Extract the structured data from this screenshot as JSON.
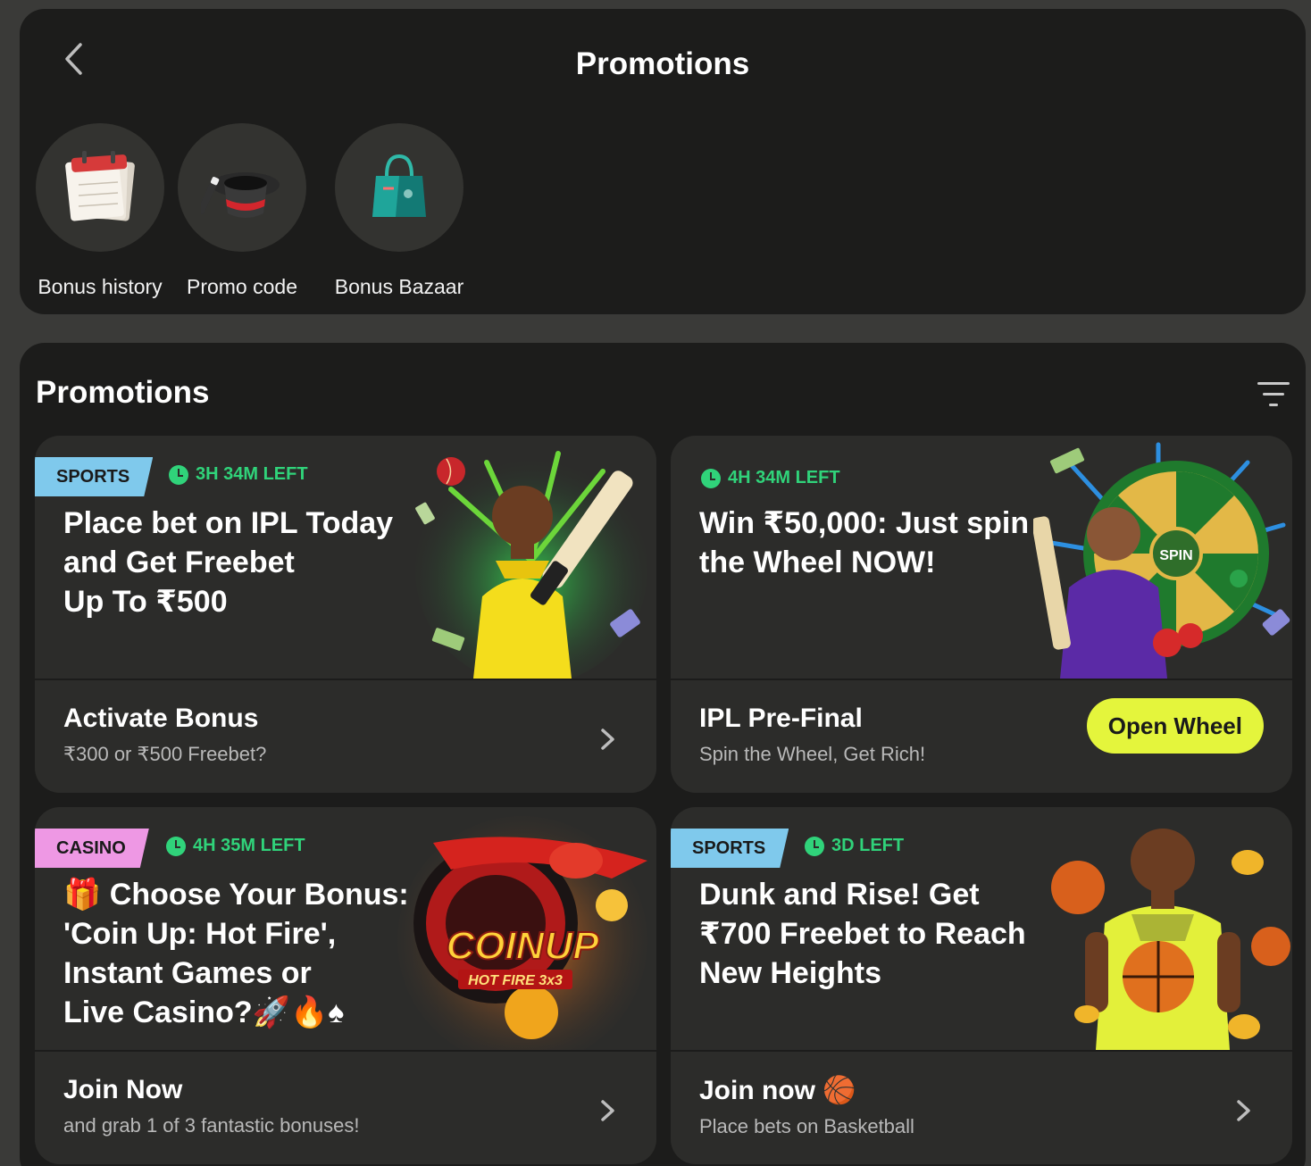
{
  "header": {
    "title": "Promotions"
  },
  "quick_links": [
    {
      "label": "Bonus history",
      "icon": "calendar-icon"
    },
    {
      "label": "Promo code",
      "icon": "magic-hat-icon"
    },
    {
      "label": "Bonus Bazaar",
      "icon": "shopping-bag-icon"
    }
  ],
  "section": {
    "title": "Promotions"
  },
  "cards": [
    {
      "tag": "SPORTS",
      "timer": "3H 34M LEFT",
      "headline": [
        "Place bet on IPL Today",
        "and Get Freebet",
        "Up To ₹500"
      ],
      "bottom_title": "Activate Bonus",
      "bottom_sub": "₹300 or ₹500 Freebet?"
    },
    {
      "tag": "",
      "timer": "4H 34M LEFT",
      "headline": [
        "Win ₹50,000: Just spin",
        "the Wheel NOW!"
      ],
      "bottom_title": "IPL Pre-Final",
      "bottom_sub": "Spin the Wheel, Get Rich!",
      "action": "Open Wheel",
      "wheel_label": "SPIN"
    },
    {
      "tag": "CASINO",
      "timer": "4H 35M LEFT",
      "headline": [
        "🎁 Choose Your Bonus:",
        "'Coin Up: Hot Fire',",
        "Instant Games or",
        "Live Casino?🚀🔥♠"
      ],
      "bottom_title": "Join Now",
      "bottom_sub": "and grab 1 of 3 fantastic bonuses!",
      "logo_main": "COINUP",
      "logo_sub": "HOT FIRE 3x3"
    },
    {
      "tag": "SPORTS",
      "timer": "3D LEFT",
      "headline": [
        "Dunk and Rise! Get",
        "₹700 Freebet to Reach",
        "New Heights"
      ],
      "bottom_title": "Join now 🏀",
      "bottom_sub": "Place bets on Basketball"
    }
  ],
  "colors": {
    "accent_yellow": "#e4f53c",
    "timer_green": "#30d37a",
    "sports_tag": "#7fc9ec",
    "casino_tag": "#ee98e4"
  }
}
